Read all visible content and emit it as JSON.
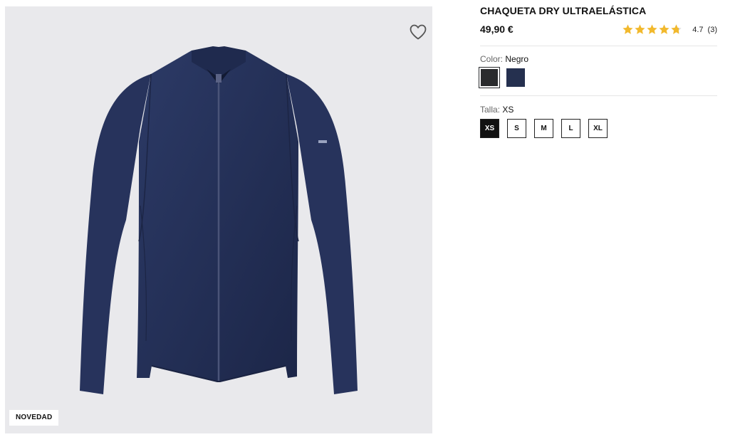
{
  "product": {
    "badge": "NOVEDAD",
    "title": "CHAQUETA DRY ULTRAELÁSTICA",
    "price": "49,90 €",
    "rating": {
      "value": "4.7",
      "count": "(3)",
      "stars": 4.7,
      "star_color": "#f2b92d"
    },
    "image": {
      "description_icon": "navy-zip-jacket",
      "background": "#e9e9ec"
    }
  },
  "color": {
    "label": "Color:",
    "selected": "Negro",
    "options": [
      {
        "name": "black",
        "hex": "#2a2b2d",
        "selected": true
      },
      {
        "name": "navy",
        "hex": "#25304f",
        "selected": false
      }
    ]
  },
  "size": {
    "label": "Talla:",
    "selected": "XS",
    "options": [
      "XS",
      "S",
      "M",
      "L",
      "XL"
    ]
  },
  "icons": {
    "wishlist": "heart-outline-icon",
    "star": "star-icon"
  }
}
